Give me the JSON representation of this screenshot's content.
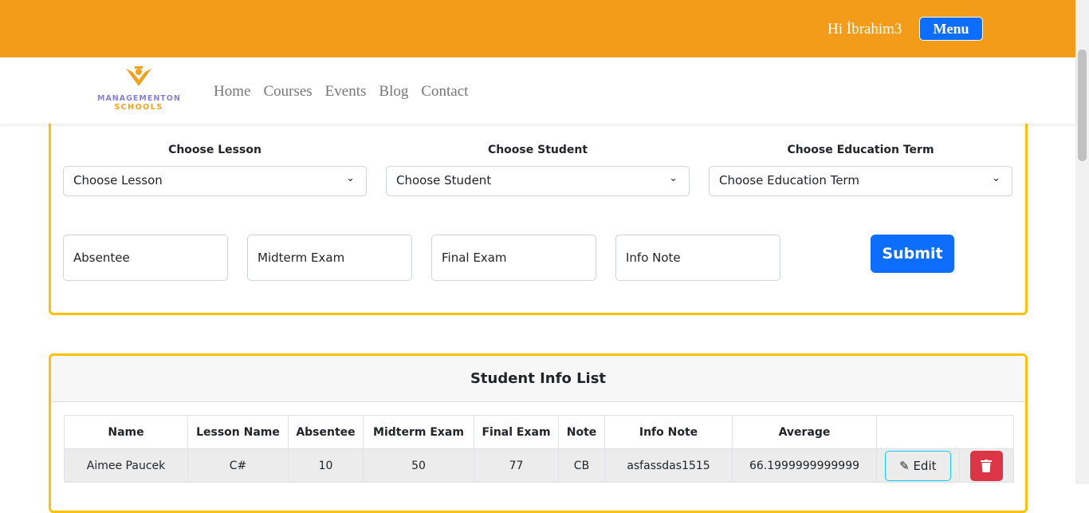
{
  "header": {
    "greeting": "Hi İbrahim3",
    "menu_label": "Menu",
    "brand_color": "#f39c1a"
  },
  "logo": {
    "line1": "MANAGEMENTON",
    "line2": "SCHOOLS"
  },
  "nav": [
    "Home",
    "Courses",
    "Events",
    "Blog",
    "Contact"
  ],
  "form": {
    "selects": [
      {
        "label": "Choose Lesson",
        "value": "Choose Lesson"
      },
      {
        "label": "Choose Student",
        "value": "Choose Student"
      },
      {
        "label": "Choose Education Term",
        "value": "Choose Education Term"
      }
    ],
    "inputs": [
      "Absentee",
      "Midterm Exam",
      "Final Exam",
      "Info Note"
    ],
    "submit": "Submit"
  },
  "list": {
    "title": "Student Info List",
    "columns": [
      "Name",
      "Lesson Name",
      "Absentee",
      "Midterm Exam",
      "Final Exam",
      "Note",
      "Info Note",
      "Average",
      ""
    ],
    "rows": [
      [
        "Aimee Paucek",
        "C#",
        "10",
        "50",
        "77",
        "CB",
        "asfassdas1515",
        "66.1999999999999"
      ]
    ],
    "edit_label": "Edit"
  }
}
